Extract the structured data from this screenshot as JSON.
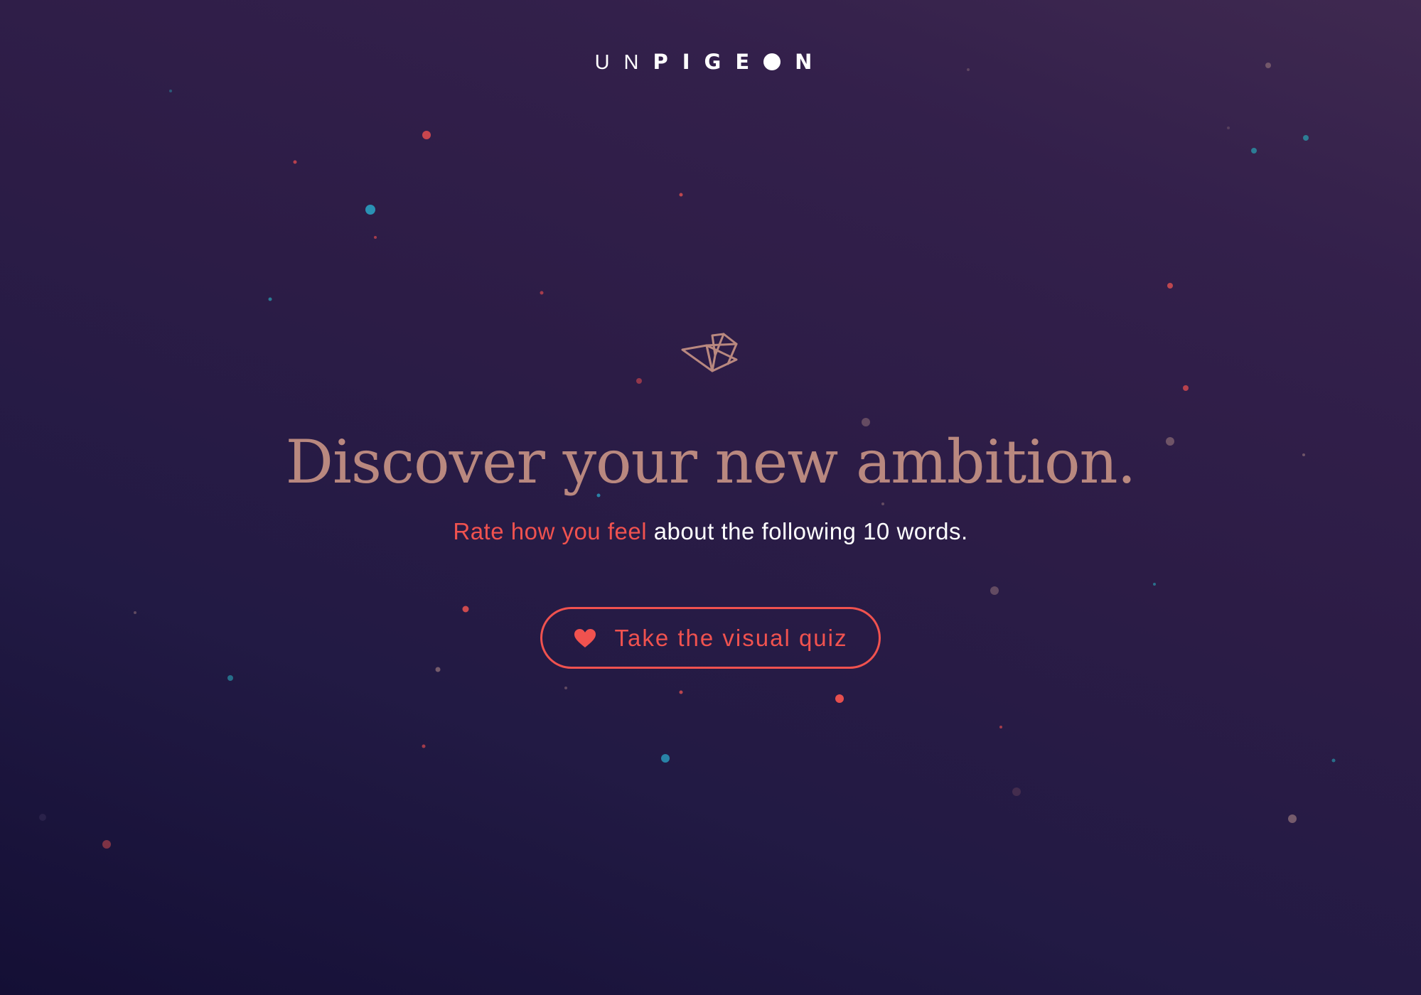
{
  "header": {
    "logo_part1": "UN",
    "logo_part2": "PIGE",
    "logo_part3": "N",
    "logo_full": "UNPIGEON"
  },
  "hero": {
    "icon": "origami-bird-icon",
    "headline": "Discover your new ambition.",
    "sub_accent": "Rate how you feel",
    "sub_rest": " about the following 10 words."
  },
  "cta": {
    "icon": "heart-icon",
    "label": "Take the visual quiz"
  },
  "colors": {
    "background_dark": "#140f35",
    "background_light": "#3f2950",
    "accent": "#f0524f",
    "headline": "#b9887f",
    "text": "#ffffff",
    "particle_teal": "#2a93a8"
  }
}
